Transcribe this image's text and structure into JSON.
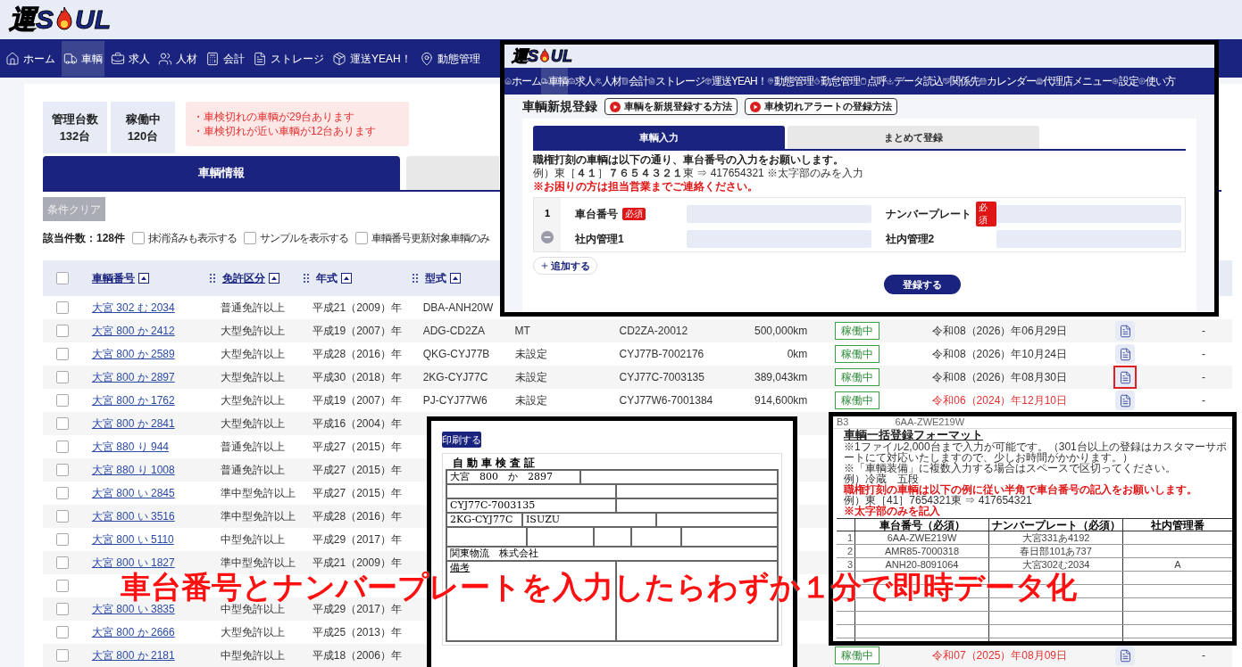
{
  "header": {
    "logo": [
      "運",
      "S",
      "UL"
    ]
  },
  "nav": [
    {
      "label": "ホーム",
      "selected": false
    },
    {
      "label": "車輌",
      "selected": true
    },
    {
      "label": "求人",
      "selected": false
    },
    {
      "label": "人材",
      "selected": false
    },
    {
      "label": "会計",
      "selected": false
    },
    {
      "label": "ストレージ",
      "selected": false
    },
    {
      "label": "運送YEAH！",
      "selected": false
    },
    {
      "label": "動態管理",
      "selected": false
    }
  ],
  "stats": [
    {
      "label": "管理台数",
      "value": "132台"
    },
    {
      "label": "稼働中",
      "value": "120台"
    }
  ],
  "alerts": [
    "・車検切れの車輌が29台あります",
    "・車検切れが近い車輌が12台あります"
  ],
  "tabs": [
    {
      "label": "車輌情報",
      "selected": true
    }
  ],
  "clear_button": {
    "label": "条件クリア",
    "disabled": true
  },
  "result_count": "該当件数：128件",
  "filters": [
    {
      "label": "抹消済みも表示する",
      "checked": false
    },
    {
      "label": "サンプルを表示する",
      "checked": false
    },
    {
      "label": "車輌番号更新対象車輌のみ",
      "checked": false
    }
  ],
  "table": {
    "select_all_checked": false,
    "columns": [
      "車輌番号",
      "免許区分",
      "年式",
      "型式"
    ],
    "rows": [
      {
        "checked": false,
        "number": "大宮 302 む 2034",
        "license": "普通免許以上",
        "year": "平成21（2009）年",
        "model": "DBA-ANH20W"
      },
      {
        "checked": false,
        "number": "大宮 800 か 2412",
        "license": "大型免許以上",
        "year": "平成19（2007）年",
        "model": "ADG-CD2ZA",
        "transmission": "MT",
        "chassis": "CD2ZA-20012",
        "mileage": "500,000km",
        "status": "稼働中",
        "inspection": "令和08（2026）年06月29日",
        "expired": false,
        "highlighted": false,
        "note": "-"
      },
      {
        "checked": false,
        "number": "大宮 800 か 2589",
        "license": "大型免許以上",
        "year": "平成28（2016）年",
        "model": "QKG-CYJ77B",
        "transmission": "未設定",
        "chassis": "CYJ77B-7002176",
        "mileage": "0km",
        "status": "稼働中",
        "inspection": "令和08（2026）年10月24日",
        "expired": false,
        "highlighted": false,
        "note": "-"
      },
      {
        "checked": false,
        "number": "大宮 800 か 2897",
        "license": "大型免許以上",
        "year": "平成30（2018）年",
        "model": "2KG-CYJ77C",
        "transmission": "未設定",
        "chassis": "CYJ77C-7003135",
        "mileage": "389,043km",
        "status": "稼働中",
        "inspection": "令和08（2026）年08月30日",
        "expired": false,
        "highlighted": true,
        "note": "-"
      },
      {
        "checked": false,
        "number": "大宮 800 か 1762",
        "license": "大型免許以上",
        "year": "平成19（2007）年",
        "model": "PJ-CYJ77W6",
        "transmission": "未設定",
        "chassis": "CYJ77W6-7001384",
        "mileage": "914,600km",
        "status": "稼働中",
        "inspection": "令和06（2024）年12月10日",
        "expired": true,
        "highlighted": false,
        "note": "-"
      },
      {
        "checked": false,
        "number": "大宮 800 か 2841",
        "license": "大型免許以上",
        "year": "平成16（2004）年"
      },
      {
        "checked": false,
        "number": "大宮 880 り 944",
        "license": "普通免許以上",
        "year": "平成27（2015）年"
      },
      {
        "checked": false,
        "number": "大宮 880 り 1008",
        "license": "普通免許以上",
        "year": "平成27（2015）年"
      },
      {
        "checked": false,
        "number": "大宮 800 い 2845",
        "license": "準中型免許以上",
        "year": "平成27（2015）年"
      },
      {
        "checked": false,
        "number": "大宮 800 い 3516",
        "license": "準中型免許以上",
        "year": "平成28（2016）年"
      },
      {
        "checked": false,
        "number": "大宮 800 い 5110",
        "license": "中型免許以上",
        "year": "平成29（2017）年"
      },
      {
        "checked": false,
        "number": "大宮 800 い 1827",
        "license": "準中型免許以上",
        "year": "平成21（2009）年"
      },
      {
        "checked": false
      },
      {
        "checked": false,
        "number": "大宮 800 い 3835",
        "license": "中型免許以上",
        "year": "平成29（2017）年"
      },
      {
        "checked": false,
        "number": "大宮 800 か 2666",
        "license": "大型免許以上",
        "year": "平成25（2013）年"
      },
      {
        "checked": false,
        "number": "大宮 800 か 2181",
        "license": "中型免許以上",
        "year": "平成18（2006）年",
        "status": "稼働中",
        "inspection": "令和07（2025）年08月09日",
        "expired": true,
        "highlighted": false,
        "note": "-"
      }
    ]
  },
  "register_inset": {
    "logo": [
      "運",
      "S",
      "UL"
    ],
    "nav": [
      {
        "label": "ホーム",
        "selected": false
      },
      {
        "label": "車輌",
        "selected": true
      },
      {
        "label": "求人",
        "selected": false
      },
      {
        "label": "人材",
        "selected": false
      },
      {
        "label": "会計",
        "selected": false
      },
      {
        "label": "ストレージ",
        "selected": false
      },
      {
        "label": "運送YEAH！",
        "selected": false
      },
      {
        "label": "動態管理",
        "selected": false
      },
      {
        "label": "勤怠管理",
        "selected": false
      },
      {
        "label": "点呼",
        "selected": false
      },
      {
        "label": "データ読込",
        "selected": false
      },
      {
        "label": "関係先",
        "selected": false
      },
      {
        "label": "カレンダー",
        "selected": false
      },
      {
        "label": "代理店メニュー",
        "selected": false
      },
      {
        "label": "設定",
        "selected": false
      },
      {
        "label": "使い方",
        "selected": false
      }
    ],
    "title": "車輌新規登録",
    "help_buttons": [
      "車輌を新規登録する方法",
      "車検切れアラートの登録方法"
    ],
    "tabs": [
      {
        "label": "車輌入力",
        "selected": true
      },
      {
        "label": "まとめて登録",
        "selected": false
      }
    ],
    "notes": [
      {
        "kind": "plain",
        "text": "職権打刻の車輌は以下の通り、車台番号の入力をお願いします。"
      },
      {
        "kind": "example",
        "text": "例）東［**４１**］**７６５４３２１**東 ⇒ 417654321 ※太字部のみを入力"
      },
      {
        "kind": "warning",
        "text": "※お困りの方は担当営業までご連絡ください。"
      }
    ],
    "row_number": "1",
    "fields": [
      {
        "label": "車台番号",
        "required": "必須"
      },
      {
        "label": "ナンバープレート",
        "required": "必須"
      },
      {
        "label": "社内管理1"
      },
      {
        "label": "社内管理2"
      }
    ],
    "add_button": "追加する",
    "submit_button": "登録する"
  },
  "certificate_inset": {
    "print_button": "印刷する",
    "title": "自動車検査証",
    "plate": "大宮　800　か　2897",
    "chassis": "CYJ77C-7003135",
    "model": "2KG-CYJ77C",
    "engine": "ISUZU",
    "owner": "関東物流　株式会社",
    "remarks": "備考"
  },
  "excel_inset": {
    "cell_ref": "B3",
    "formula": "6AA-ZWE219W",
    "title": "車輌一括登録フォーマット",
    "notes": [
      {
        "kind": "plain",
        "text": "※1ファイル2,000台まで入力が可能です。（301台以上の登録はカスタマーサポートにて対応いたしますので、少しお時間がかかります。）"
      },
      {
        "kind": "plain",
        "text": "※「車輌装備」に複数入力する場合はスペースで区切ってください。"
      },
      {
        "kind": "plain",
        "text": "例）冷蔵　五段"
      },
      {
        "kind": "warning",
        "text": "職権打刻の車輌は以下の例に従い半角で車台番号の記入をお願いします。"
      },
      {
        "kind": "plain",
        "text": "例）東［41］7654321東 ⇒ 417654321"
      },
      {
        "kind": "warning",
        "text": "※太字部のみを記入"
      }
    ],
    "columns": [
      "車台番号（必須）",
      "ナンバープレート（必須）",
      "社内管理番"
    ],
    "rows": [
      {
        "no": "1",
        "cells": [
          "6AA-ZWE219W",
          "大宮331あ4192",
          null
        ]
      },
      {
        "no": "2",
        "cells": [
          "AMR85-7000318",
          "春日部101あ737",
          null
        ]
      },
      {
        "no": "3",
        "cells": [
          "ANH20-8091064",
          "大宮302む2034",
          "A"
        ]
      }
    ]
  },
  "caption": "車台番号とナンバープレートを入力したらわずか１分で即時データ化"
}
